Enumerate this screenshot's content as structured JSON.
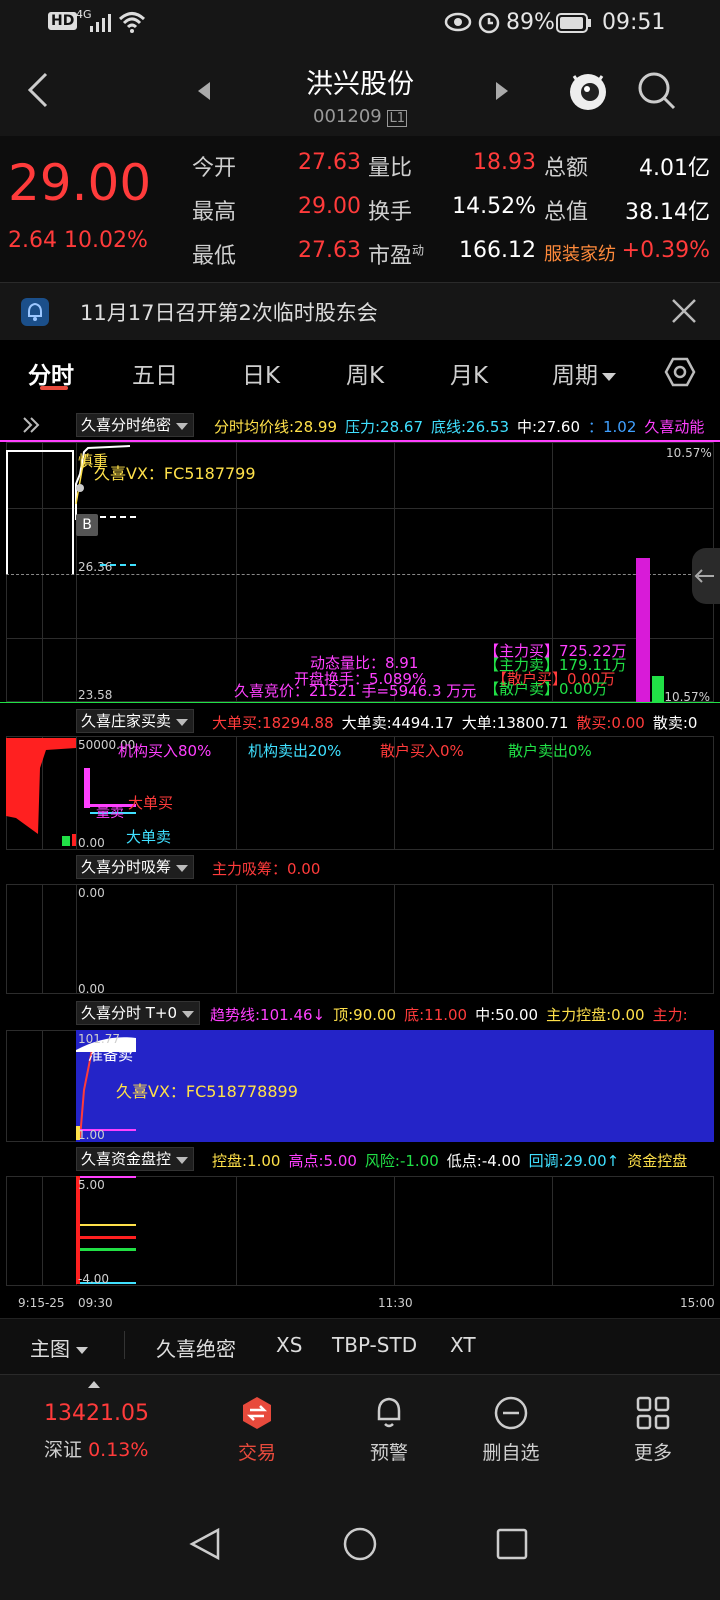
{
  "status": {
    "network": "4G",
    "hd": "HD",
    "battery": "89%",
    "time": "09:51"
  },
  "header": {
    "stock_name": "洪兴股份",
    "stock_code": "001209",
    "level_badge": "L1"
  },
  "quote": {
    "price": "29.00",
    "change": "2.64",
    "change_pct": "10.02%",
    "rows": [
      {
        "l1": "今开",
        "v1": "27.63",
        "l2": "量比",
        "v2": "18.93",
        "l3": "总额",
        "v3": "4.01亿"
      },
      {
        "l1": "最高",
        "v1": "29.00",
        "l2": "换手",
        "v2": "14.52%",
        "l3": "总值",
        "v3": "38.14亿"
      },
      {
        "l1": "最低",
        "v1": "27.63",
        "l2": "市盈",
        "l2sup": "动",
        "v2": "166.12",
        "l3": "服装家纺",
        "v3": "+0.39%"
      }
    ]
  },
  "notice": {
    "text": "11月17日召开第2次临时股东会"
  },
  "tabs": [
    "分时",
    "五日",
    "日K",
    "周K",
    "月K",
    "周期"
  ],
  "panel1": {
    "indicator": "久喜分时绝密",
    "params": [
      {
        "text": "分时均价线:28.99",
        "color": "#ffe14a"
      },
      {
        "text": "压力:28.67",
        "color": "#40e0ff"
      },
      {
        "text": "底线:26.53",
        "color": "#40e0ff"
      },
      {
        "text": "中:27.60",
        "color": "#ffffff"
      },
      {
        "text": "：1.02",
        "color": "#40a0ff"
      },
      {
        "text": "久喜动能",
        "color": "#ff40ff"
      }
    ],
    "top_right": "10.57%",
    "bottom_right": "-10.57%",
    "y_top": "",
    "y_mid": "26.36",
    "y_bottom": "23.58",
    "watermark1": "慎重",
    "watermark2": "久喜VX：FC5187799",
    "marker_b": "B",
    "dyn_ratio": "动态量比：8.91",
    "open_turnover": "开盘换手：5.089%",
    "auction": "久喜竞价：21521 手=5946.3 万元",
    "main_buy": "【主力买】725.22万",
    "main_sell": "【主力卖】179.11万",
    "retail_buy": "【散户买】0.00万",
    "retail_sell": "【散户卖】0.00万"
  },
  "panel2": {
    "indicator": "久喜庄家买卖",
    "params": [
      {
        "text": "大单买:18294.88",
        "color": "#ff3b3b"
      },
      {
        "text": "大单卖:4494.17",
        "color": "#ffffff"
      },
      {
        "text": "大单:13800.71",
        "color": "#ffffff"
      },
      {
        "text": "散买:0.00",
        "color": "#ff3b3b"
      },
      {
        "text": "散卖:0",
        "color": "#ffffff"
      }
    ],
    "y_top": "50000.00",
    "y_bottom": "0.00",
    "inst_buy": "机构买入80%",
    "inst_sell": "机构卖出20%",
    "retail_buy": "散户买入0%",
    "retail_sell": "散户卖出0%",
    "big_buy": "大单买",
    "big_sell": "大单卖",
    "sell_lbl": "量卖"
  },
  "panel3": {
    "indicator": "久喜分时吸筹",
    "params": [
      {
        "text": "主力吸筹：0.00",
        "color": "#ff3b3b"
      }
    ],
    "y_top": "0.00",
    "y_bottom": "0.00"
  },
  "panel4": {
    "indicator": "久喜分时 T+0",
    "params": [
      {
        "text": "趋势线:101.46↓",
        "color": "#ff40ff"
      },
      {
        "text": "顶:90.00",
        "color": "#ffe14a"
      },
      {
        "text": "底:11.00",
        "color": "#ff3b3b"
      },
      {
        "text": "中:50.00",
        "color": "#ffffff"
      },
      {
        "text": "主力控盘:0.00",
        "color": "#ffe14a"
      },
      {
        "text": "主力:",
        "color": "#ff3b3b"
      }
    ],
    "y_top": "101.77",
    "y_bottom": "1.00",
    "prepare_sell": "准备卖",
    "watermark": "久喜VX：FC518778899"
  },
  "panel5": {
    "indicator": "久喜资金盘控",
    "params": [
      {
        "text": "控盘:1.00",
        "color": "#ffe14a"
      },
      {
        "text": "高点:5.00",
        "color": "#ff40ff"
      },
      {
        "text": "风险:-1.00",
        "color": "#21e046"
      },
      {
        "text": "低点:-4.00",
        "color": "#ffffff"
      },
      {
        "text": "回调:29.00↑",
        "color": "#40e0ff"
      },
      {
        "text": "资金控盘",
        "color": "#ffe14a"
      }
    ],
    "y_top": "5.00",
    "y_bottom": "-4.00"
  },
  "time_axis": {
    "pre": "9:15-25",
    "open": "09:30",
    "mid": "11:30",
    "close": "15:00"
  },
  "indicator_tabs": {
    "main": "主图",
    "items": [
      "久喜绝密",
      "XS",
      "TBP-STD",
      "XT"
    ]
  },
  "bottom_nav": {
    "index_value": "13421.05",
    "index_name": "深证",
    "index_change": "0.13%",
    "items": [
      "交易",
      "预警",
      "删自选",
      "更多"
    ]
  },
  "colors": {
    "up": "#ff3b3b",
    "down": "#21e046",
    "bg": "#000000",
    "accent": "#e84a3c"
  }
}
